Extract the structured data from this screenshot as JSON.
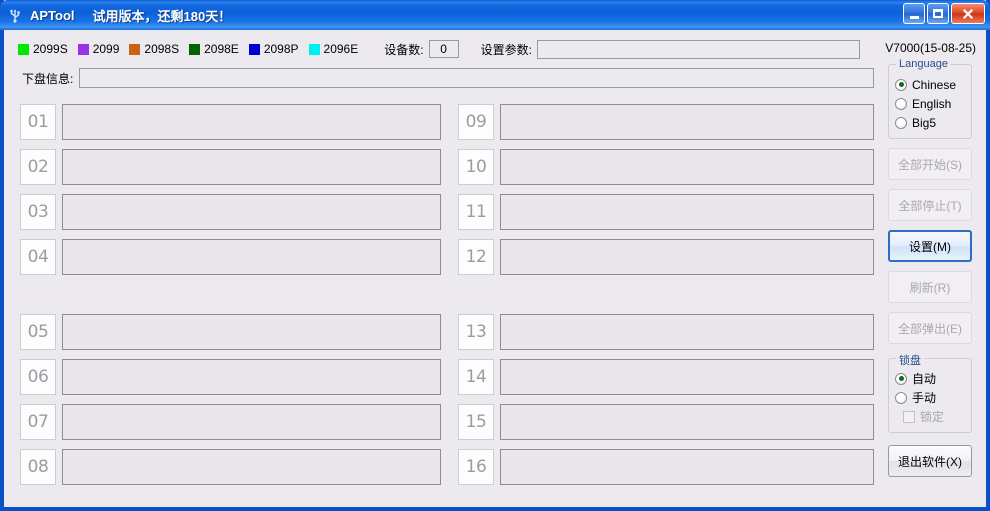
{
  "window": {
    "title": "APTool",
    "subtitle": "试用版本，还剩180天！",
    "icon": "usb-icon",
    "minimize_label": "",
    "maximize_label": "",
    "close_label": "✕"
  },
  "legend": [
    {
      "label": "2099S",
      "color": "#00e800"
    },
    {
      "label": "2099",
      "color": "#9b30e8"
    },
    {
      "label": "2098S",
      "color": "#c86414"
    },
    {
      "label": "2098E",
      "color": "#006400"
    },
    {
      "label": "2098P",
      "color": "#0000d2"
    },
    {
      "label": "2096E",
      "color": "#00f0f0"
    }
  ],
  "toolbar": {
    "device_count_label": "设备数:",
    "device_count_value": "0",
    "param_label": "设置参数:",
    "param_value": "",
    "param_placeholder": "",
    "version": "V7000(15-08-25)"
  },
  "info": {
    "label": "下盘信息:",
    "value": "",
    "placeholder": ""
  },
  "slots": {
    "group_top_left": [
      {
        "id": "01",
        "value": ""
      },
      {
        "id": "02",
        "value": ""
      },
      {
        "id": "03",
        "value": ""
      },
      {
        "id": "04",
        "value": ""
      }
    ],
    "group_top_right": [
      {
        "id": "09",
        "value": ""
      },
      {
        "id": "10",
        "value": ""
      },
      {
        "id": "11",
        "value": ""
      },
      {
        "id": "12",
        "value": ""
      }
    ],
    "group_bottom_left": [
      {
        "id": "05",
        "value": ""
      },
      {
        "id": "06",
        "value": ""
      },
      {
        "id": "07",
        "value": ""
      },
      {
        "id": "08",
        "value": ""
      }
    ],
    "group_bottom_right": [
      {
        "id": "13",
        "value": ""
      },
      {
        "id": "14",
        "value": ""
      },
      {
        "id": "15",
        "value": ""
      },
      {
        "id": "16",
        "value": ""
      }
    ]
  },
  "sidebar": {
    "language_group": {
      "title": "Language",
      "options": [
        {
          "label": "Chinese",
          "selected": true
        },
        {
          "label": "English",
          "selected": false
        },
        {
          "label": "Big5",
          "selected": false
        }
      ]
    },
    "buttons": [
      {
        "label": "全部开始(S)",
        "state": "disabled"
      },
      {
        "label": "全部停止(T)",
        "state": "disabled"
      },
      {
        "label": "设置(M)",
        "state": "focused"
      },
      {
        "label": "刷新(R)",
        "state": "disabled"
      },
      {
        "label": "全部弹出(E)",
        "state": "disabled"
      }
    ],
    "lock_group": {
      "title": "锁盘",
      "options": [
        {
          "label": "自动",
          "selected": true
        },
        {
          "label": "手动",
          "selected": false
        }
      ],
      "checkbox": {
        "label": "锁定",
        "checked": false,
        "state": "disabled"
      }
    },
    "exit_button": {
      "label": "退出软件(X)",
      "state": "enabled"
    }
  }
}
